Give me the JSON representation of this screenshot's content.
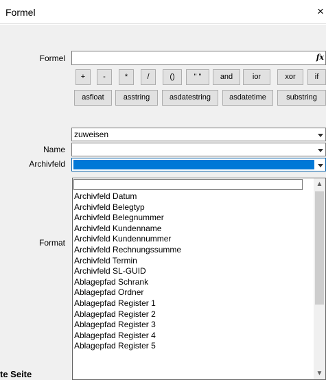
{
  "window": {
    "title": "Formel",
    "close_glyph": "×"
  },
  "formel": {
    "label": "Formel",
    "fx_glyph": "fx",
    "value": ""
  },
  "operator_buttons": [
    "+",
    "-",
    "*",
    "/",
    "()",
    "\" \"",
    "and",
    "ior",
    "xor",
    "if"
  ],
  "function_buttons": [
    "asfloat",
    "asstring",
    "asdatestring",
    "asdatetime",
    "substring"
  ],
  "zuweisen": {
    "value": "zuweisen"
  },
  "name": {
    "label": "Name",
    "value": ""
  },
  "archivfeld": {
    "label": "Archivfeld",
    "value": ""
  },
  "format": {
    "label": "Format"
  },
  "dropdown": {
    "search_value": "",
    "items": [
      "Archivfeld Datum",
      "Archivfeld Belegtyp",
      "Archivfeld Belegnummer",
      "Archivfeld Kundenname",
      "Archivfeld Kundennummer",
      "Archivfeld Rechnungssumme",
      "Archivfeld Termin",
      "Archivfeld SL-GUID",
      "Ablagepfad Schrank",
      "Ablagepfad Ordner",
      "Ablagepfad Register  1",
      "Ablagepfad Register  2",
      "Ablagepfad Register  3",
      "Ablagepfad Register  4",
      "Ablagepfad Register  5"
    ]
  },
  "footer": {
    "tab_label": "te Seite"
  },
  "colors": {
    "selection": "#0078d7",
    "background": "#f0f0f0"
  }
}
